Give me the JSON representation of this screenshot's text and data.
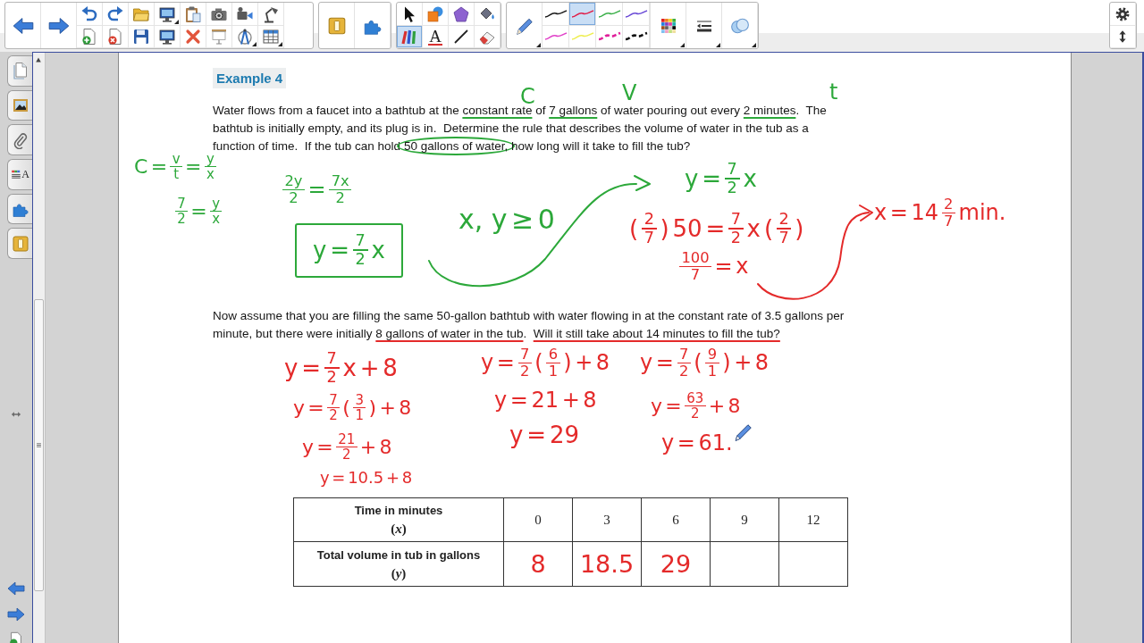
{
  "toolbar": {
    "tools": [
      {
        "selected": false
      },
      {
        "selected": false
      },
      {
        "selected": false
      },
      {
        "selected": false
      },
      {
        "selected": true
      },
      {
        "selected": false
      },
      {
        "selected": false
      },
      {
        "selected": false
      }
    ],
    "text_tool_glyph": "A",
    "pen_styles": [
      {
        "kind": "solid",
        "color": "#1a1a1a",
        "selected": false
      },
      {
        "kind": "solid",
        "color": "#e0204a",
        "selected": true
      },
      {
        "kind": "solid",
        "color": "#3cb04a",
        "selected": false
      },
      {
        "kind": "solid",
        "color": "#6a4ad6",
        "selected": false
      },
      {
        "kind": "solid",
        "color": "#e040c8",
        "selected": false
      },
      {
        "kind": "solid",
        "color": "#eeee50",
        "selected": false
      },
      {
        "kind": "dashed",
        "color": "#e0209a",
        "selected": false
      },
      {
        "kind": "dashed",
        "color": "#111111",
        "selected": false
      }
    ]
  },
  "sidebar": {
    "properties_glyph": "A"
  },
  "page": {
    "heading": "Example 4",
    "problem_1": [
      [
        {
          "kind": "plain",
          "text": "Water flows from a faucet into a bathtub at the "
        },
        {
          "kind": "underlined",
          "text": "constant rate"
        },
        {
          "kind": "plain",
          "text": " of "
        },
        {
          "kind": "underlined",
          "text": "7 gallons"
        },
        {
          "kind": "plain",
          "text": " of water pouring out every "
        },
        {
          "kind": "underlined",
          "text": "2 minutes"
        },
        {
          "kind": "plain",
          "text": ".  The"
        }
      ],
      [
        {
          "kind": "plain",
          "text": "bathtub is initially empty, and its plug is in.  Determine the rule that describes the volume of water in the tub as a"
        }
      ],
      [
        {
          "kind": "plain",
          "text": "function of time.  If the tub can hold "
        },
        {
          "kind": "circled",
          "text": "50 gallons of water,"
        },
        {
          "kind": "plain",
          "text": " how long will it take to fill the tub?"
        }
      ]
    ],
    "problem_2": [
      [
        {
          "kind": "plain",
          "text": "Now assume that you are filling the same 50-gallon bathtub with water flowing in at the constant rate of 3.5 gallons per"
        }
      ],
      [
        {
          "kind": "plain",
          "text": "minute, but there were initially "
        },
        {
          "kind": "underlined",
          "text": "8 gallons of water in the tub"
        },
        {
          "kind": "plain",
          "text": ".  "
        },
        {
          "kind": "underlined",
          "text": "Will it still take about 14 minutes to fill the tub?"
        }
      ]
    ],
    "table": {
      "rows": [
        {
          "label": "Time in minutes",
          "variable": "(*x*)",
          "cells": [
            {
              "kind": "typed",
              "text": "0"
            },
            {
              "kind": "typed",
              "text": "3"
            },
            {
              "kind": "typed",
              "text": "6"
            },
            {
              "kind": "typed",
              "text": "9"
            },
            {
              "kind": "typed",
              "text": "12"
            }
          ]
        },
        {
          "label": "Total volume in tub in gallons",
          "variable": "(*y*)",
          "cells": [
            {
              "kind": "ink",
              "text": "8"
            },
            {
              "kind": "ink",
              "text": "18.5"
            },
            {
              "kind": "ink",
              "text": "29"
            },
            {
              "kind": "empty"
            },
            {
              "kind": "empty"
            }
          ]
        }
      ]
    }
  },
  "ink": [
    {
      "color": "#2ca83a",
      "boxed": false,
      "parts": [
        "C"
      ]
    },
    {
      "color": "#2ca83a",
      "boxed": false,
      "parts": [
        "V"
      ]
    },
    {
      "color": "#2ca83a",
      "boxed": false,
      "parts": [
        "t"
      ]
    },
    {
      "color": "#2ca83a",
      "boxed": false,
      "parts": [
        "C",
        "=",
        {
          "num": "v",
          "den": "t"
        },
        "=",
        {
          "num": "y",
          "den": "x"
        }
      ]
    },
    {
      "color": "#2ca83a",
      "boxed": false,
      "parts": [
        {
          "num": "7",
          "den": "2"
        },
        "=",
        {
          "num": "y",
          "den": "x"
        }
      ]
    },
    {
      "color": "#2ca83a",
      "boxed": false,
      "parts": [
        {
          "num": "2y",
          "den": "2"
        },
        "=",
        {
          "num": "7x",
          "den": "2"
        }
      ]
    },
    {
      "color": "#2ca83a",
      "boxed": true,
      "parts": [
        "y",
        "=",
        {
          "num": "7",
          "den": "2"
        },
        "x"
      ]
    },
    {
      "color": "#2ca83a",
      "boxed": false,
      "parts": [
        "x, y",
        "≥",
        "0"
      ]
    },
    {
      "color": "#2ca83a",
      "boxed": false,
      "parts": [
        "y",
        "=",
        {
          "num": "7",
          "den": "2"
        },
        "x"
      ]
    },
    {
      "color": "#e42a2a",
      "boxed": false,
      "parts": [
        "(",
        {
          "num": "2",
          "den": "7"
        },
        ")",
        "50",
        "=",
        {
          "num": "7",
          "den": "2"
        },
        "x",
        "(",
        {
          "num": "2",
          "den": "7"
        },
        ")"
      ]
    },
    {
      "color": "#e42a2a",
      "boxed": false,
      "parts": [
        {
          "num": "100",
          "den": "7"
        },
        "=",
        "x"
      ]
    },
    {
      "color": "#e42a2a",
      "boxed": false,
      "parts": [
        "x",
        "=",
        "14",
        {
          "num": "2",
          "den": "7"
        },
        "min."
      ]
    },
    {
      "color": "#e42a2a",
      "boxed": false,
      "parts": [
        "y",
        "=",
        {
          "num": "7",
          "den": "2"
        },
        "x",
        "+",
        "8"
      ]
    },
    {
      "color": "#e42a2a",
      "boxed": false,
      "parts": [
        "y",
        "=",
        {
          "num": "7",
          "den": "2"
        },
        "(",
        {
          "num": "3",
          "den": "1"
        },
        ")",
        "+",
        "8"
      ]
    },
    {
      "color": "#e42a2a",
      "boxed": false,
      "parts": [
        "y",
        "=",
        {
          "num": "21",
          "den": "2"
        },
        "+",
        "8"
      ]
    },
    {
      "color": "#e42a2a",
      "boxed": false,
      "parts": [
        "y",
        "=",
        "10.5",
        "+",
        "8"
      ]
    },
    {
      "color": "#e42a2a",
      "boxed": false,
      "parts": [
        "y",
        "=",
        {
          "num": "7",
          "den": "2"
        },
        "(",
        {
          "num": "6",
          "den": "1"
        },
        ")",
        "+",
        "8"
      ]
    },
    {
      "color": "#e42a2a",
      "boxed": false,
      "parts": [
        "y",
        "=",
        "21",
        "+",
        "8"
      ]
    },
    {
      "color": "#e42a2a",
      "boxed": false,
      "parts": [
        "y",
        "=",
        "29"
      ]
    },
    {
      "color": "#e42a2a",
      "boxed": false,
      "parts": [
        "y",
        "=",
        {
          "num": "7",
          "den": "2"
        },
        "(",
        {
          "num": "9",
          "den": "1"
        },
        ")",
        "+",
        "8"
      ]
    },
    {
      "color": "#e42a2a",
      "boxed": false,
      "parts": [
        "y",
        "=",
        {
          "num": "63",
          "den": "2"
        },
        "+",
        "8"
      ]
    },
    {
      "color": "#e42a2a",
      "boxed": false,
      "parts": [
        "y",
        "=",
        "61."
      ]
    }
  ]
}
